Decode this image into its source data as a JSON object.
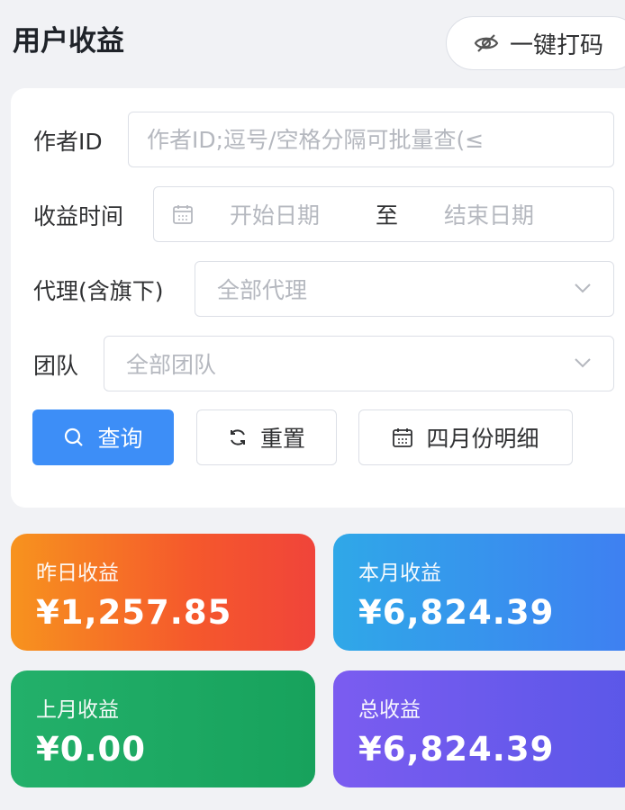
{
  "header": {
    "title": "用户收益",
    "mask_button_label": "一键打码"
  },
  "form": {
    "author_id": {
      "label": "作者ID",
      "placeholder": "作者ID;逗号/空格分隔可批量查(≤"
    },
    "income_time": {
      "label": "收益时间",
      "start_placeholder": "开始日期",
      "separator": "至",
      "end_placeholder": "结束日期"
    },
    "agent": {
      "label": "代理(含旗下)",
      "selected": "全部代理"
    },
    "team": {
      "label": "团队",
      "selected": "全部团队"
    }
  },
  "actions": {
    "query_label": "查询",
    "reset_label": "重置",
    "april_detail_label": "四月份明细"
  },
  "stats": {
    "yesterday": {
      "label": "昨日收益",
      "value": "¥1,257.85"
    },
    "this_month": {
      "label": "本月收益",
      "value": "¥6,824.39"
    },
    "last_month": {
      "label": "上月收益",
      "value": "¥0.00"
    },
    "total": {
      "label": "总收益",
      "value": "¥6,824.39"
    }
  },
  "colors": {
    "primary": "#3d8ef7",
    "yesterday": "#f5582c",
    "this_month": "#3f7ef2",
    "last_month": "#17a25c",
    "total": "#6a59ec"
  }
}
